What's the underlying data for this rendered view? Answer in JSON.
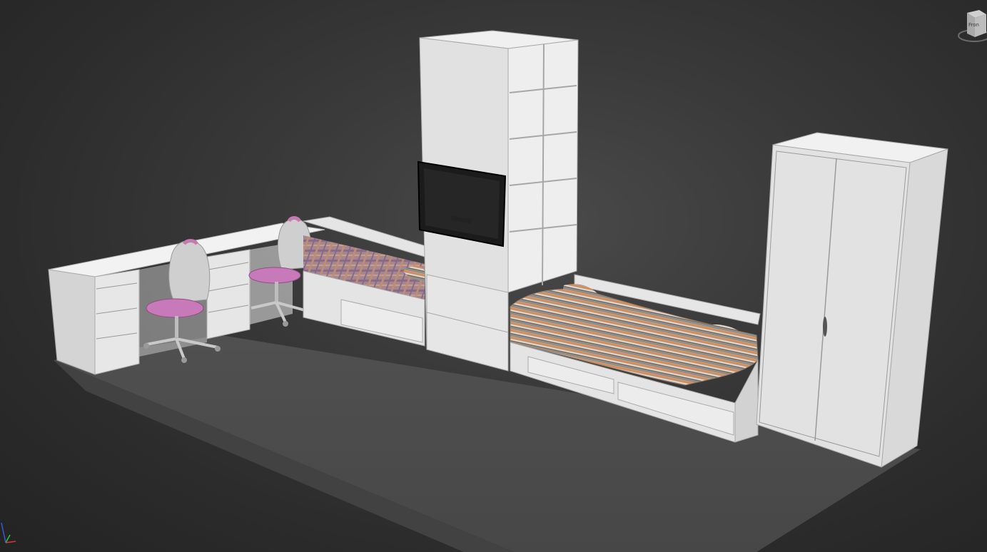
{
  "viewport": {
    "background": "#353535"
  },
  "view_cube": {
    "icon": "view-cube-icon",
    "face_label": "Fron"
  },
  "axis_gizmo": {
    "icon": "axis-tripod-icon",
    "axes": [
      {
        "name": "x",
        "color": "#d23a3a"
      },
      {
        "name": "y",
        "color": "#3ac23a"
      },
      {
        "name": "z",
        "color": "#3a5ad2"
      }
    ]
  },
  "scene_objects": [
    {
      "name": "floor-plane"
    },
    {
      "name": "desk"
    },
    {
      "name": "office-chair-left"
    },
    {
      "name": "office-chair-right"
    },
    {
      "name": "bed-plaid"
    },
    {
      "name": "tall-shelving-cabinet"
    },
    {
      "name": "tv-screen"
    },
    {
      "name": "bed-striped"
    },
    {
      "name": "wardrobe"
    }
  ],
  "colors": {
    "furniture_light": "#efefef",
    "furniture_mid": "#d6d6d6",
    "furniture_dark": "#bdbdbd",
    "floor_top": "#4c4c4c",
    "floor_edge": "#3a3a3a",
    "chair_seat": "#c879b9",
    "tv": "#1b1b1b",
    "plaid": "#b58a8f",
    "stripes": "#c9a98a"
  }
}
